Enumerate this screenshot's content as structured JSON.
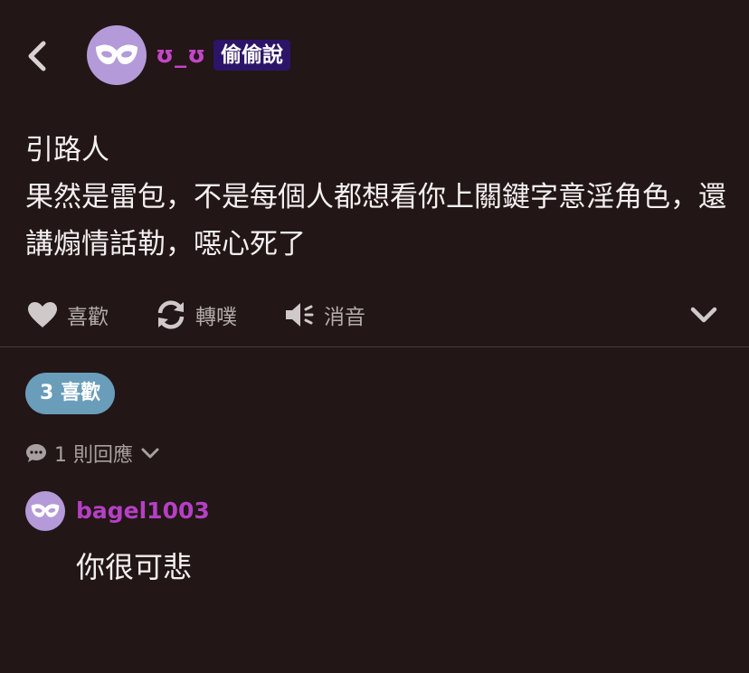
{
  "header": {
    "username": "ʊ_ʊ",
    "board_tag": "偷偷說"
  },
  "post": {
    "text": "引路人\n果然是雷包，不是每個人都想看你上關鍵字意淫角色，還講煽情話勒，噁心死了"
  },
  "actions": {
    "like_label": "喜歡",
    "repost_label": "轉噗",
    "mute_label": "消音"
  },
  "likes": {
    "count": "3",
    "label": "喜歡"
  },
  "replies": {
    "count_label": "1 則回應"
  },
  "comment": {
    "username": "bagel1003",
    "text": "你很可悲"
  },
  "colors": {
    "background": "#221616",
    "username": "#c446c8",
    "board_tag_bg": "#2c1468",
    "likes_pill": "#6a9db9",
    "avatar": "#b49ad8"
  },
  "icons": [
    "back-chevron-icon",
    "mask-icon",
    "heart-icon",
    "repost-icon",
    "mute-speaker-icon",
    "chevron-down-icon",
    "speech-bubble-icon"
  ]
}
